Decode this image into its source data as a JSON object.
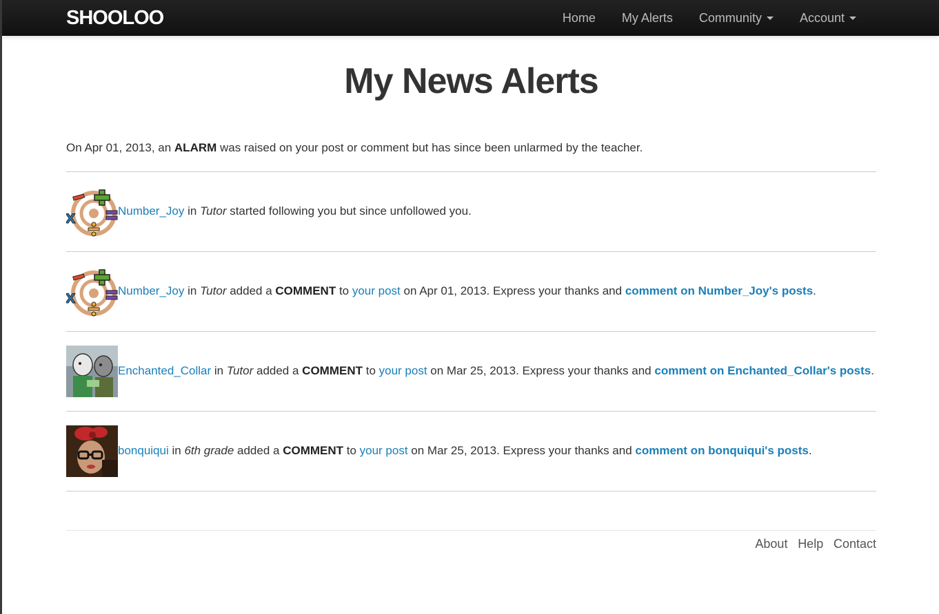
{
  "navbar": {
    "brand": "SHOOLOO",
    "items": [
      {
        "label": "Home",
        "dropdown": false
      },
      {
        "label": "My Alerts",
        "dropdown": false
      },
      {
        "label": "Community",
        "dropdown": true
      },
      {
        "label": "Account",
        "dropdown": true
      }
    ]
  },
  "page_title": "My News Alerts",
  "first_alert": {
    "prefix": "On Apr 01, 2013, an ",
    "keyword": "ALARM",
    "suffix": " was raised on your post or comment but has since been unlarmed by the teacher."
  },
  "alerts": [
    {
      "user": "Number_Joy",
      "in_text": " in ",
      "group": "Tutor",
      "action": " started following you but since unfollowed you."
    },
    {
      "user": "Number_Joy",
      "in_text": " in ",
      "group": "Tutor",
      "added": " added a ",
      "keyword": "COMMENT",
      "to": " to ",
      "post_link": "your post",
      "date_text": " on Apr 01, 2013. Express your thanks and ",
      "comment_link": "comment on Number_Joy's posts",
      "end": "."
    },
    {
      "user": "Enchanted_Collar",
      "in_text": " in ",
      "group": "Tutor",
      "added": " added a ",
      "keyword": "COMMENT",
      "to": " to ",
      "post_link": "your post",
      "date_text": " on Mar 25, 2013. Express your thanks and ",
      "comment_link": "comment on Enchanted_Collar's posts",
      "end": "."
    },
    {
      "user": "bonquiqui",
      "in_text": " in ",
      "group": "6th grade",
      "added": " added a ",
      "keyword": "COMMENT",
      "to": " to ",
      "post_link": "your post",
      "date_text": " on Mar 25, 2013. Express your thanks and ",
      "comment_link": "comment on bonquiqui's posts",
      "end": "."
    }
  ],
  "footer": {
    "links": [
      "About",
      "Help",
      "Contact"
    ]
  },
  "colors": {
    "link": "#1a7fb8",
    "navbar": "#1a1a1a"
  }
}
